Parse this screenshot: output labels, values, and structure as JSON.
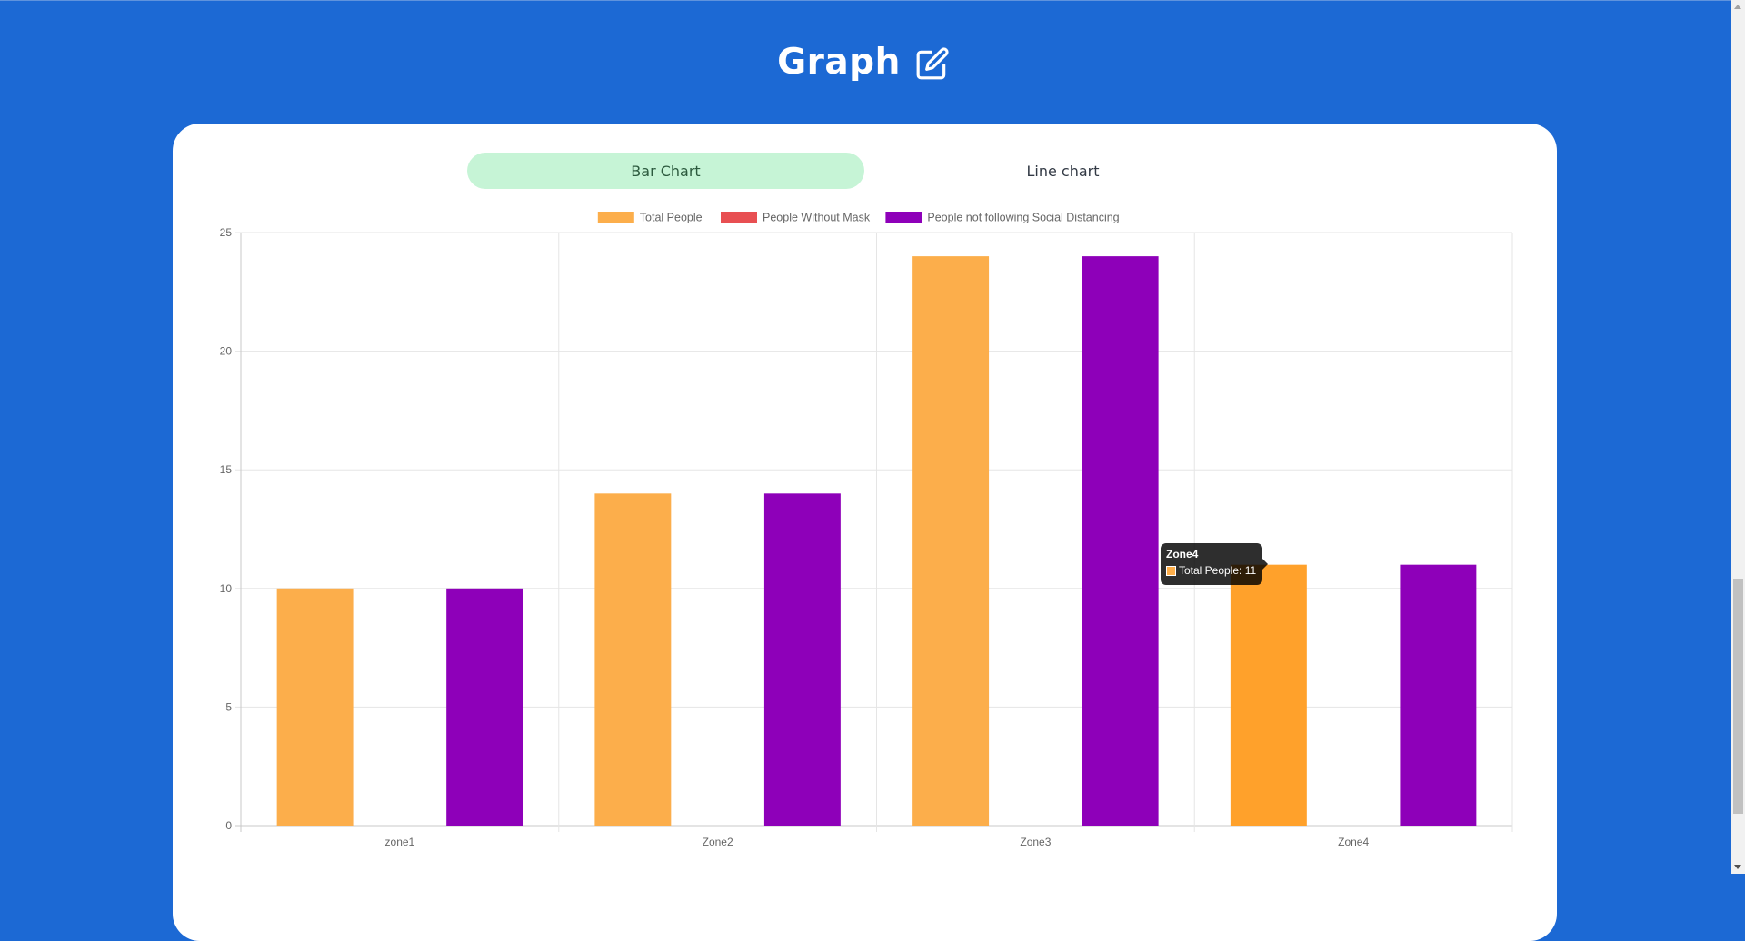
{
  "header": {
    "title": "Graph",
    "icon": "edit-icon"
  },
  "tabs": [
    {
      "label": "Bar Chart",
      "active": true
    },
    {
      "label": "Line chart",
      "active": false
    }
  ],
  "colors": {
    "page_background": "#1c69d4",
    "active_tab": "#c6f4d6"
  },
  "chart_data": {
    "type": "bar",
    "categories": [
      "zone1",
      "Zone2",
      "Zone3",
      "Zone4"
    ],
    "series": [
      {
        "name": "Total People",
        "values": [
          10,
          14,
          24,
          11
        ],
        "color": "#fcae4b"
      },
      {
        "name": "People Without Mask",
        "values": [
          0,
          0,
          0,
          0
        ],
        "color": "#e84f52"
      },
      {
        "name": "People not following Social Distancing",
        "values": [
          10,
          14,
          24,
          11
        ],
        "color": "#8e00b9"
      }
    ],
    "ylim": [
      0,
      25
    ],
    "yticks": [
      "0",
      "5",
      "10",
      "15",
      "20",
      "25"
    ],
    "grid": true,
    "legend": "top",
    "tooltip": {
      "title": "Zone4",
      "label": "Total People: 11",
      "color": "#fcae4b"
    }
  }
}
